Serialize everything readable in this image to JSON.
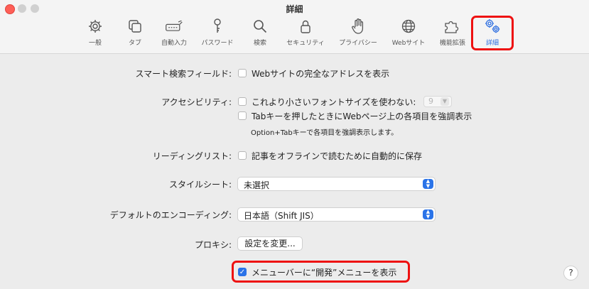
{
  "window": {
    "title": "詳細"
  },
  "tabs": [
    {
      "label": "一般",
      "icon": "gear-icon"
    },
    {
      "label": "タブ",
      "icon": "tabs-icon"
    },
    {
      "label": "自動入力",
      "icon": "autofill-icon"
    },
    {
      "label": "パスワード",
      "icon": "key-icon"
    },
    {
      "label": "検索",
      "icon": "search-icon"
    },
    {
      "label": "セキュリティ",
      "icon": "lock-icon"
    },
    {
      "label": "プライバシー",
      "icon": "hand-icon"
    },
    {
      "label": "Webサイト",
      "icon": "globe-icon"
    },
    {
      "label": "機能拡張",
      "icon": "puzzle-icon"
    },
    {
      "label": "詳細",
      "icon": "gears-icon",
      "active": true
    }
  ],
  "settings": {
    "smart_search": {
      "label": "スマート検索フィールド:",
      "option": "Webサイトの完全なアドレスを表示",
      "checked": false
    },
    "accessibility": {
      "label": "アクセシビリティ:",
      "option1": "これより小さいフォントサイズを使わない:",
      "option1_checked": false,
      "font_size": "9",
      "option2": "Tabキーを押したときにWebページ上の各項目を強調表示",
      "option2_checked": false,
      "note": "Option+Tabキーで各項目を強調表示します。"
    },
    "reading_list": {
      "label": "リーディングリスト:",
      "option": "記事をオフラインで読むために自動的に保存",
      "checked": false
    },
    "stylesheet": {
      "label": "スタイルシート:",
      "value": "未選択"
    },
    "encoding": {
      "label": "デフォルトのエンコーディング:",
      "value": "日本語（Shift JIS）"
    },
    "proxy": {
      "label": "プロキシ:",
      "button": "設定を変更..."
    },
    "develop_menu": {
      "option": "メニューバーに“開発”メニューを表示",
      "checked": true
    }
  },
  "help": {
    "label": "?"
  },
  "colors": {
    "accent": "#2a73e8",
    "highlight": "#e11111",
    "close": "#fe5f57"
  }
}
